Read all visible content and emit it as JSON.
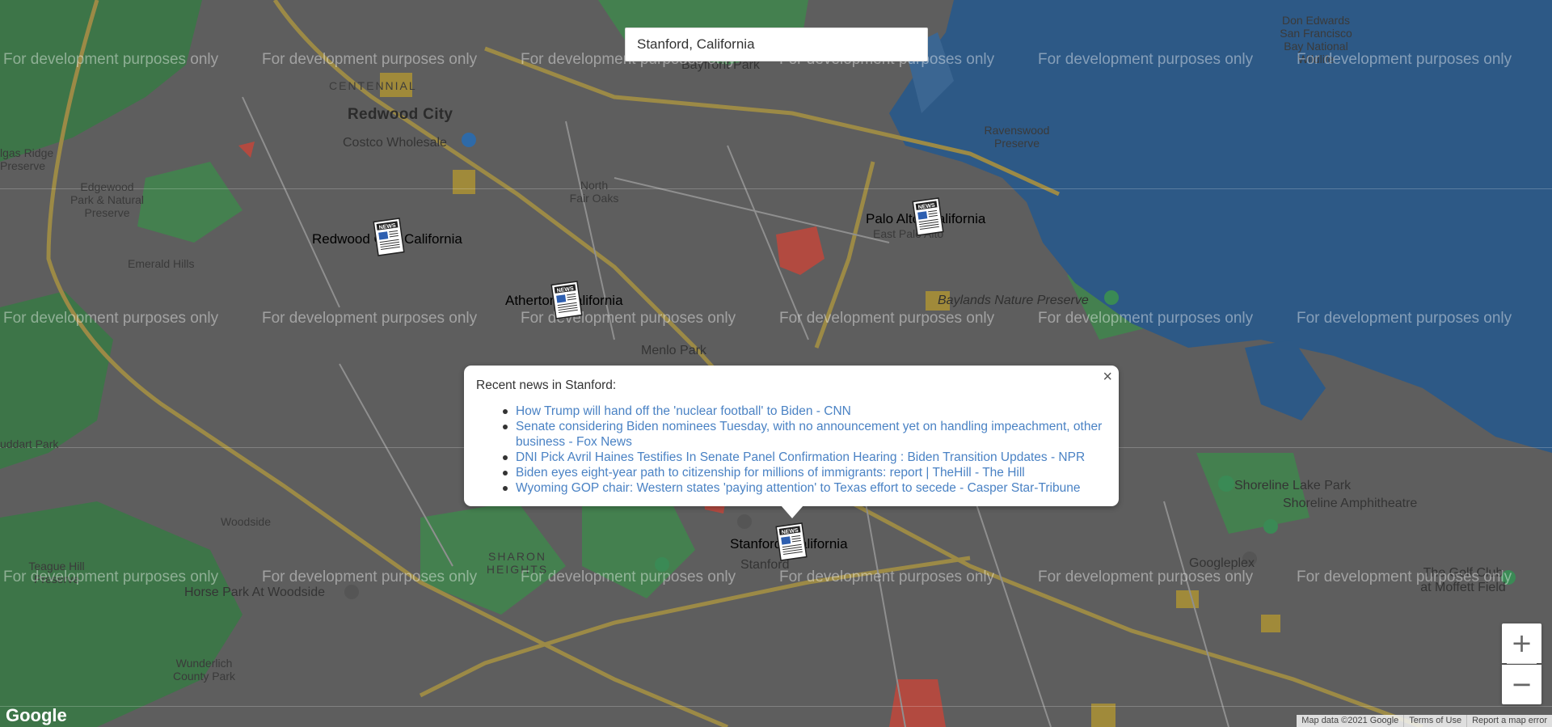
{
  "search": {
    "value": "Stanford, California"
  },
  "place_labels": {
    "redwood_city": "Redwood City",
    "centennial": "CENTENNIAL",
    "costco": "Costco Wholesale",
    "algas_ridge_1": "lgas Ridge",
    "algas_ridge_2": "Preserve",
    "edgewood_1": "Edgewood",
    "edgewood_2": "Park & Natural",
    "edgewood_3": "Preserve",
    "north_fair_oaks_1": "North",
    "north_fair_oaks_2": "Fair Oaks",
    "emerald_hills": "Emerald Hills",
    "menlo_park": "Menlo Park",
    "bayfront_park": "Bayfront Park",
    "ravenswood_1": "Ravenswood",
    "ravenswood_2": "Preserve",
    "don_edwards_1": "Don Edwards",
    "don_edwards_2": "San Francisco",
    "don_edwards_3": "Bay National",
    "don_edwards_4": "Wildlife",
    "east_palo_alto": "East Palo Alto",
    "baylands": "Baylands Nature Preserve",
    "shoreline_lake": "Shoreline Lake Park",
    "shoreline_amph": "Shoreline Amphitheatre",
    "googleplex": "Googleplex",
    "golf_club_1": "The Golf Club",
    "golf_club_2": "at Moffett Field",
    "huddart": "uddart Park",
    "woodside": "Woodside",
    "sharon_heights_1": "SHARON",
    "sharon_heights_2": "HEIGHTS",
    "stanford": "Stanford",
    "teague_hill_1": "Teague Hill",
    "teague_hill_2": "Preserve",
    "horse_park": "Horse Park At Woodside",
    "wunderlich_1": "Wunderlich",
    "wunderlich_2": "County Park"
  },
  "watermark_text": "For development purposes only",
  "markers": [
    {
      "label": "Redwood City, California"
    },
    {
      "label": "Atherton, California"
    },
    {
      "label": "Palo Alto, California"
    },
    {
      "label": "Stanford, California"
    }
  ],
  "marker_icon": "newspaper-icon",
  "info_window": {
    "heading": "Recent news in Stanford:",
    "close_label": "×",
    "news": [
      "How Trump will hand off the 'nuclear football' to Biden - CNN",
      "Senate considering Biden nominees Tuesday, with no announcement yet on handling impeachment, other business - Fox News",
      "DNI Pick Avril Haines Testifies In Senate Panel Confirmation Hearing : Biden Transition Updates - NPR",
      "Biden eyes eight-year path to citizenship for millions of immigrants: report | TheHill - The Hill",
      "Wyoming GOP chair: Western states 'paying attention' to Texas effort to secede - Casper Star-Tribune"
    ]
  },
  "zoom": {
    "in_label": "+",
    "out_label": "−"
  },
  "google_logo": "Google",
  "attribution": {
    "map_data": "Map data ©2021 Google",
    "terms": "Terms of Use",
    "report": "Report a map error"
  },
  "colors": {
    "land": "#5e5e5e",
    "water": "#2e5a8a",
    "park": "#3f7a4a",
    "road": "#a08a3a",
    "link": "#4a82c4"
  }
}
